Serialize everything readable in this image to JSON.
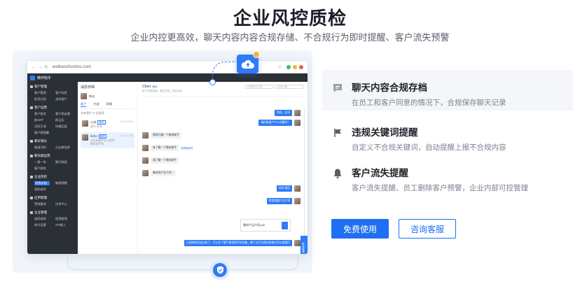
{
  "hero": {
    "title": "企业风控质检",
    "subtitle": "企业内控更高效，聊天内容内容合规存储、不合规行为即时提醒、客户流失预警"
  },
  "mockup": {
    "url": "weibanzhushou.com",
    "app_name": "微伴助手",
    "sidebar": [
      {
        "head": "客户管理",
        "rows": [
          [
            "客户管理",
            "客户标签"
          ],
          [
            "标签分组",
            "流失客户"
          ]
        ]
      },
      {
        "head": "客户运营",
        "rows": [
          [
            "客户群发",
            "客户朋友圈"
          ],
          [
            "群SOP",
            "群日历"
          ],
          [
            "活码引流",
            "快捷回复"
          ],
          [
            "客户群提醒",
            ""
          ]
        ]
      },
      {
        "head": "聊天增长",
        "rows": [
          [
            "渠道活码",
            "企业微信群"
          ]
        ]
      },
      {
        "head": "聊天群运营",
        "rows": [
          [
            "一客一码",
            "聊天群组"
          ],
          [
            "客户群发",
            ""
          ]
        ]
      },
      {
        "head": "企业风控",
        "rows": [
          [
            "消息存档",
            "敏感提醒"
          ],
          [
            "离职继承",
            ""
          ]
        ]
      },
      {
        "head": "应用管理",
        "rows": [
          [
            "营销素材",
            "应用中心"
          ]
        ]
      },
      {
        "head": "企业管理",
        "rows": [
          [
            "组织架构",
            "权限管理"
          ],
          [
            "账号设置",
            "API接入"
          ]
        ]
      }
    ],
    "selected_sidebar": "消息存档",
    "list": {
      "title": "消息存档",
      "user": "韩边",
      "tabs": [
        "客户",
        "内部",
        "群聊"
      ],
      "count": "共有客户 5 位联系",
      "items": [
        {
          "name": "小米",
          "tag": "微信",
          "msg": "[图片消息]",
          "time": "01-14 12:06"
        },
        {
          "name": "Echo",
          "tag": "微信",
          "msg": "还没有想好怎么使用...微伴助手的...",
          "time": "01-14 12:06"
        }
      ]
    },
    "chat": {
      "name": "Chorr",
      "tag": "微信",
      "sub": "客户来源渠道：通过扫描二维码添加",
      "search_placeholder": "搜索聊天记录",
      "date_placeholder": "选择日期",
      "messages": [
        {
          "side": "right",
          "text": "你好，在吗"
        },
        {
          "side": "right",
          "text": "请问有客户什么问题吗？"
        },
        {
          "side": "left",
          "text": "帮我开通一个微伴助手"
        },
        {
          "side": "left",
          "text": "有了解一下微伴助手",
          "flag": "违规敏感词"
        },
        {
          "side": "left",
          "text": "我了解一下微伴助手"
        },
        {
          "side": "left",
          "text": "微伴的产品介绍一"
        },
        {
          "side": "right",
          "text": "好的 稍后"
        },
        {
          "side": "right",
          "text": "帮我看看产品介绍"
        },
        {
          "side": "right",
          "text": "已经给您发送过来了，可以先了解下微伴助手的功能，哪个点不太明白的地方可以找我们"
        }
      ],
      "file_name": "微伴产品介绍.pdf",
      "float_tab": "联系客服"
    }
  },
  "features": [
    {
      "title": "聊天内容合规存档",
      "desc": "在员工和客户同意的情况下，合规保存聊天记录",
      "icon": "chat-icon"
    },
    {
      "title": "违规关键词提醒",
      "desc": "自定义不合规关键词，自动提醒上报不合规内容",
      "icon": "alert-icon"
    },
    {
      "title": "客户流失提醒",
      "desc": "客户流失提醒、员工删除客户预警，企业内部可控管理",
      "icon": "bell-icon"
    }
  ],
  "buttons": {
    "primary": "免费使用",
    "secondary": "咨询客服"
  },
  "colors": {
    "brand": "#1f6ff2",
    "dark_sidebar": "#2b2f36",
    "badge_yellow": "#f2b431"
  }
}
